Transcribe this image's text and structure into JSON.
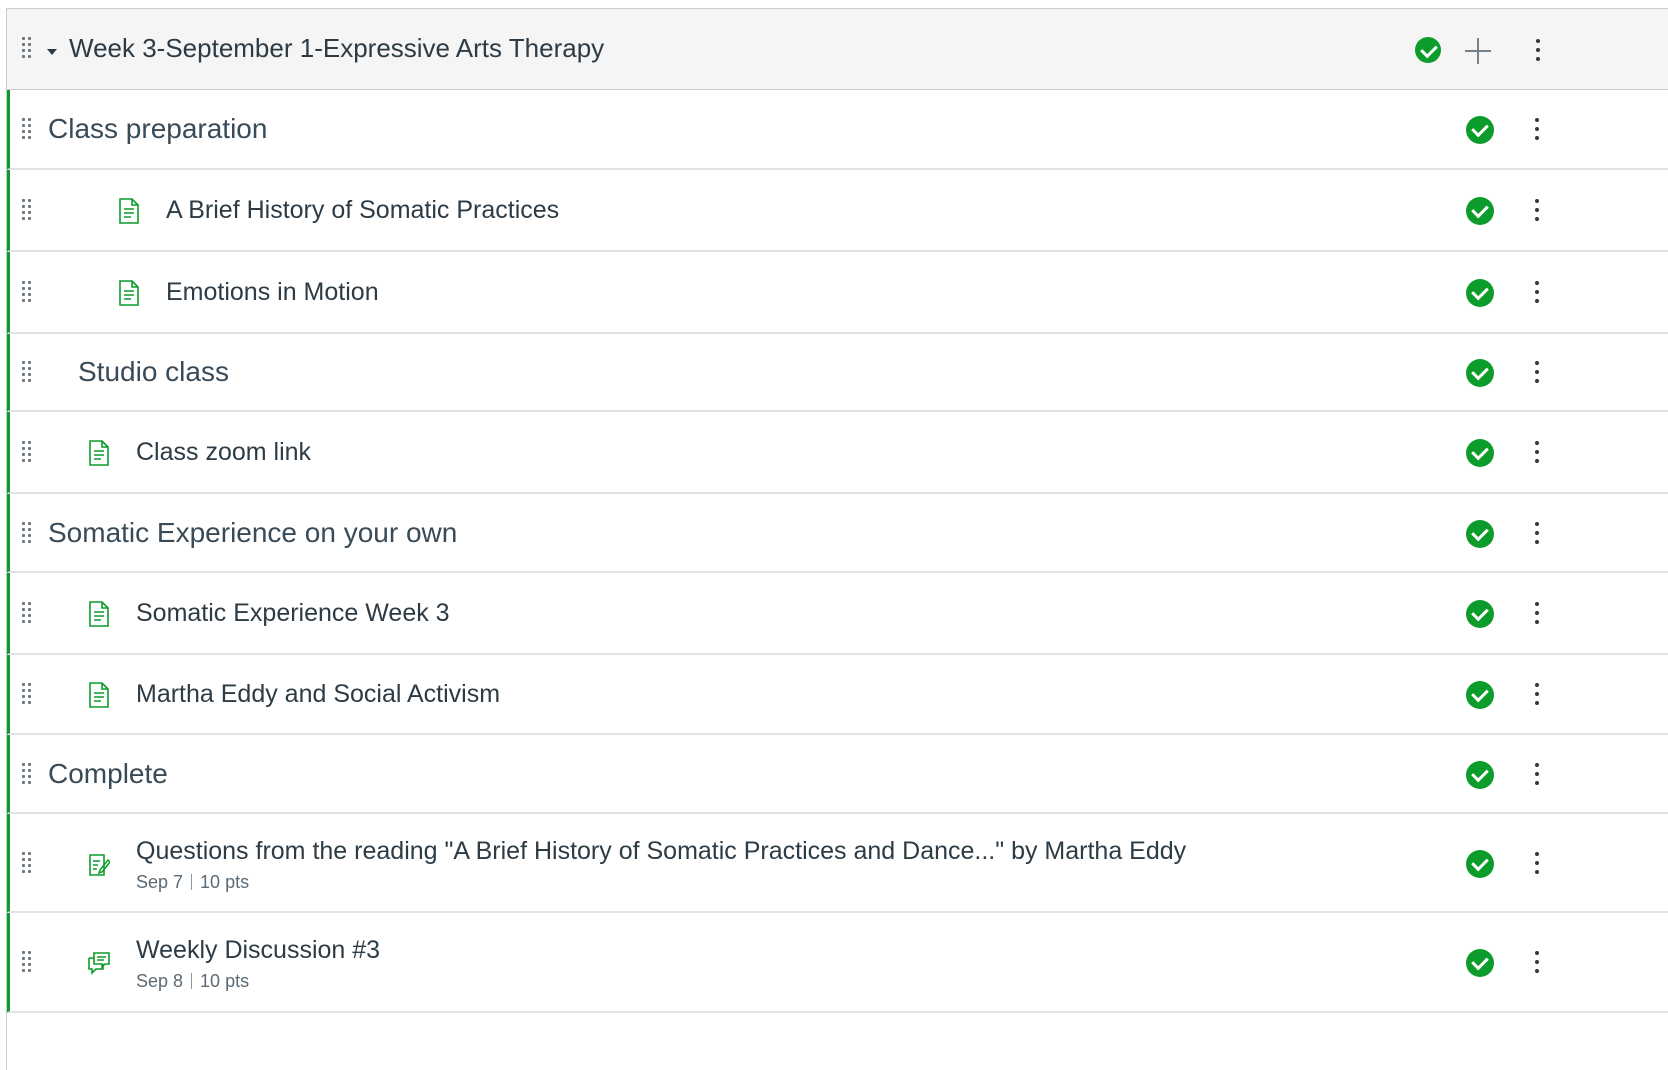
{
  "module": {
    "title": "Week 3-September 1-Expressive Arts Therapy",
    "published": true,
    "icons": {
      "drag": "drag-handle-icon",
      "collapse": "caret-down-icon",
      "publish": "published-check-icon",
      "add": "plus-icon",
      "menu": "kebab-menu-icon"
    }
  },
  "colors": {
    "published": "#0b9c2b",
    "text": "#2d3b45",
    "header_bg": "#f5f5f5",
    "divider": "#dfe3e6"
  },
  "items": [
    {
      "kind": "header",
      "title": "Class preparation",
      "indent": 0
    },
    {
      "kind": "page",
      "title": "A Brief History of Somatic Practices",
      "indent": 2,
      "icon": "document-icon"
    },
    {
      "kind": "page",
      "title": "Emotions in Motion",
      "indent": 2,
      "icon": "document-icon"
    },
    {
      "kind": "header",
      "title": "Studio class",
      "indent": 1
    },
    {
      "kind": "page",
      "title": "Class zoom link",
      "indent": 1,
      "icon": "document-icon"
    },
    {
      "kind": "header",
      "title": "Somatic Experience on your own",
      "indent": 0
    },
    {
      "kind": "page",
      "title": "Somatic Experience Week 3",
      "indent": 1,
      "icon": "document-icon"
    },
    {
      "kind": "page",
      "title": "Martha Eddy and Social Activism",
      "indent": 1,
      "icon": "document-icon"
    },
    {
      "kind": "header",
      "title": "Complete",
      "indent": 0
    },
    {
      "kind": "assignment",
      "title": "Questions from the reading \"A Brief History of Somatic Practices and Dance...\" by Martha Eddy",
      "indent": 1,
      "icon": "assignment-icon",
      "due": "Sep 7",
      "points": "10 pts"
    },
    {
      "kind": "discussion",
      "title": "Weekly Discussion #3",
      "indent": 1,
      "icon": "discussion-icon",
      "due": "Sep 8",
      "points": "10 pts"
    }
  ]
}
